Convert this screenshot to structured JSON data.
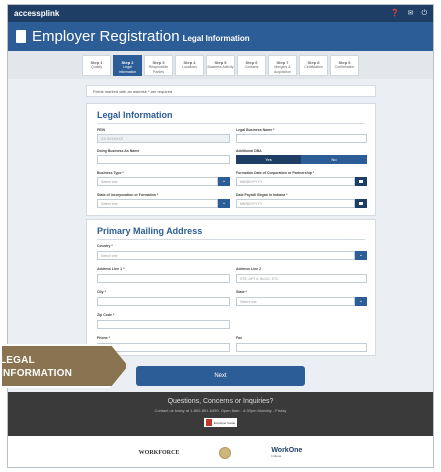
{
  "topbar": {
    "logo": "access​plink"
  },
  "header": {
    "title": "Employer Registration",
    "subtitle": "Legal Information"
  },
  "steps": [
    {
      "num": "Step 1",
      "name": "Qualify"
    },
    {
      "num": "Step 2",
      "name": "Legal Information"
    },
    {
      "num": "Step 3",
      "name": "Responsible Parties"
    },
    {
      "num": "Step 4",
      "name": "Locations"
    },
    {
      "num": "Step 5",
      "name": "Business Activity"
    },
    {
      "num": "Step 6",
      "name": "Contacts"
    },
    {
      "num": "Step 7",
      "name": "Mergers & Acquisition"
    },
    {
      "num": "Step 8",
      "name": "Certification"
    },
    {
      "num": "Step 9",
      "name": "Confirmation"
    }
  ],
  "notice": "Fields marked with an asterisk * are required",
  "legal": {
    "title": "Legal Information",
    "fein_label": "FEIN",
    "fein_value": "XX-XXXXXXX",
    "legal_name_label": "Legal Business Name *",
    "dba_label": "Doing Business As Name",
    "add_dba_label": "Additional DBA",
    "yes": "Yes",
    "no": "No",
    "business_type_label": "Business Type *",
    "business_type_placeholder": "Select one",
    "formation_date_label": "Formation Date of Corporation or Partnership *",
    "date_placeholder": "MM/DD/YYYY",
    "state_label": "State of Incorporation or Formation *",
    "state_placeholder": "Select one",
    "payroll_label": "Date Payroll Began in Indiana *",
    "payroll_placeholder": "MM/DD/YYYY"
  },
  "mailing": {
    "title": "Primary Mailing Address",
    "country_label": "Country *",
    "country_placeholder": "Select one",
    "addr1_label": "Address Line 1 *",
    "addr2_label": "Address Line 2",
    "addr2_placeholder": "STE, APT #, BLDG, ETC",
    "city_label": "City *",
    "state_label": "State *",
    "state_placeholder": "Select one",
    "zip_label": "Zip Code *",
    "phone_label": "Phone *",
    "fax_label": "Fax"
  },
  "next_button": "Next",
  "footer": {
    "question": "Questions, Concerns or Inquiries?",
    "contact": "Contact us today at 1-800-891-6499. Open 8am - 4:30pm Monday - Friday",
    "pdf_label": "Employer Guide"
  },
  "logos": {
    "workforce": "WORKFORCE",
    "workone": "WorkOne",
    "workone_sub": "Indiana"
  },
  "callout": {
    "line1": "LEGAL",
    "line2": "INFORMATION"
  }
}
